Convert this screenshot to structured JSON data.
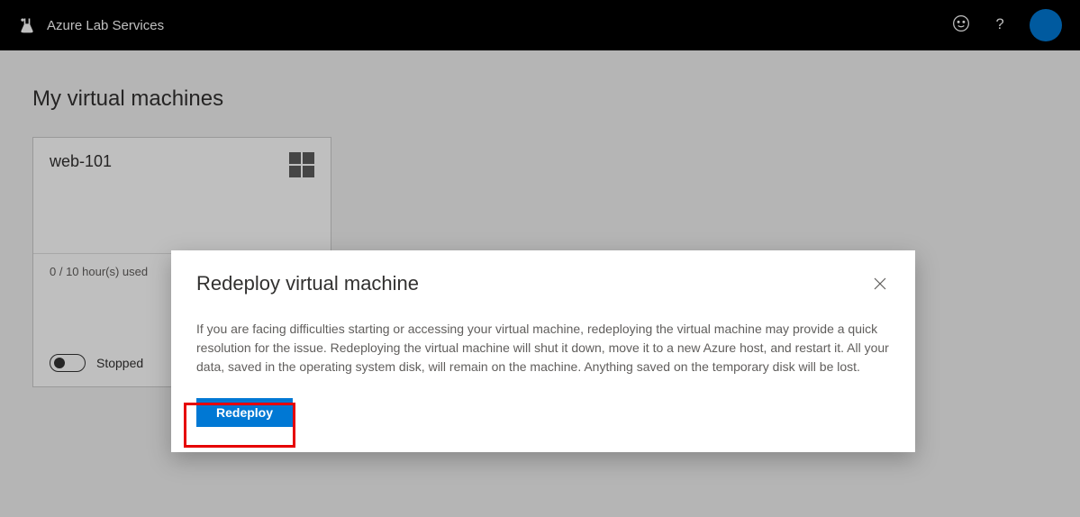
{
  "header": {
    "brand": "Azure Lab Services"
  },
  "page": {
    "title": "My virtual machines"
  },
  "vm": {
    "name": "web-101",
    "usage": "0 / 10 hour(s) used",
    "status": "Stopped"
  },
  "dialog": {
    "title": "Redeploy virtual machine",
    "body": "If you are facing difficulties starting or accessing your virtual machine, redeploying the virtual machine may provide a quick resolution for the issue. Redeploying the virtual machine will shut it down, move it to a new Azure host, and restart it. All your data, saved in the operating system disk, will remain on the machine. Anything saved on the temporary disk will be lost.",
    "redeploy_label": "Redeploy"
  }
}
